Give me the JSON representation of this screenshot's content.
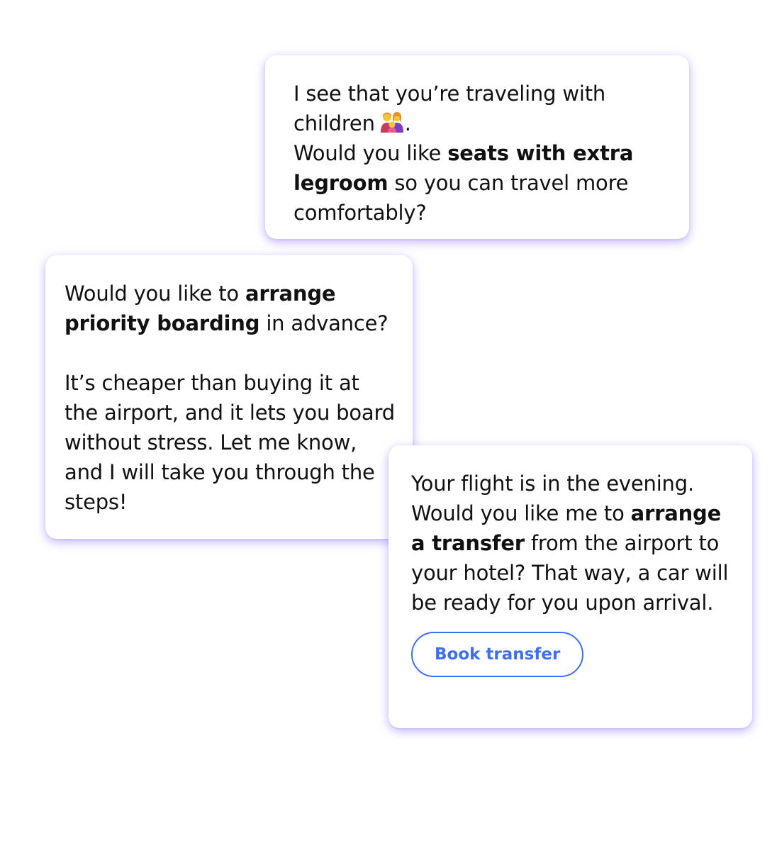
{
  "cards": {
    "seats": {
      "line1": "I see that you’re traveling with children",
      "emoji_icon": "family-woman-girl-icon",
      "line1_end": ".",
      "line2_pre": "Would you like ",
      "line2_bold": "seats with extra legroom",
      "line2_post": " so you can travel more comfortably?"
    },
    "priority": {
      "para1_pre": "Would you like to ",
      "para1_bold": "arrange priority boarding",
      "para1_post": " in advance?",
      "para2": "It’s cheaper than buying it at the airport, and it lets you board without stress. Let me know, and I will take you through the steps!"
    },
    "transfer": {
      "pre": "Your flight is in the evening. Would you like me to ",
      "bold": "arrange a transfer",
      "post": " from the airport to your hotel? That way, a car will be ready for you upon arrival.",
      "button_label": "Book transfer"
    }
  },
  "colors": {
    "accent_blue": "#3D6FF0",
    "shadow_purple": "#8C6EFF"
  }
}
